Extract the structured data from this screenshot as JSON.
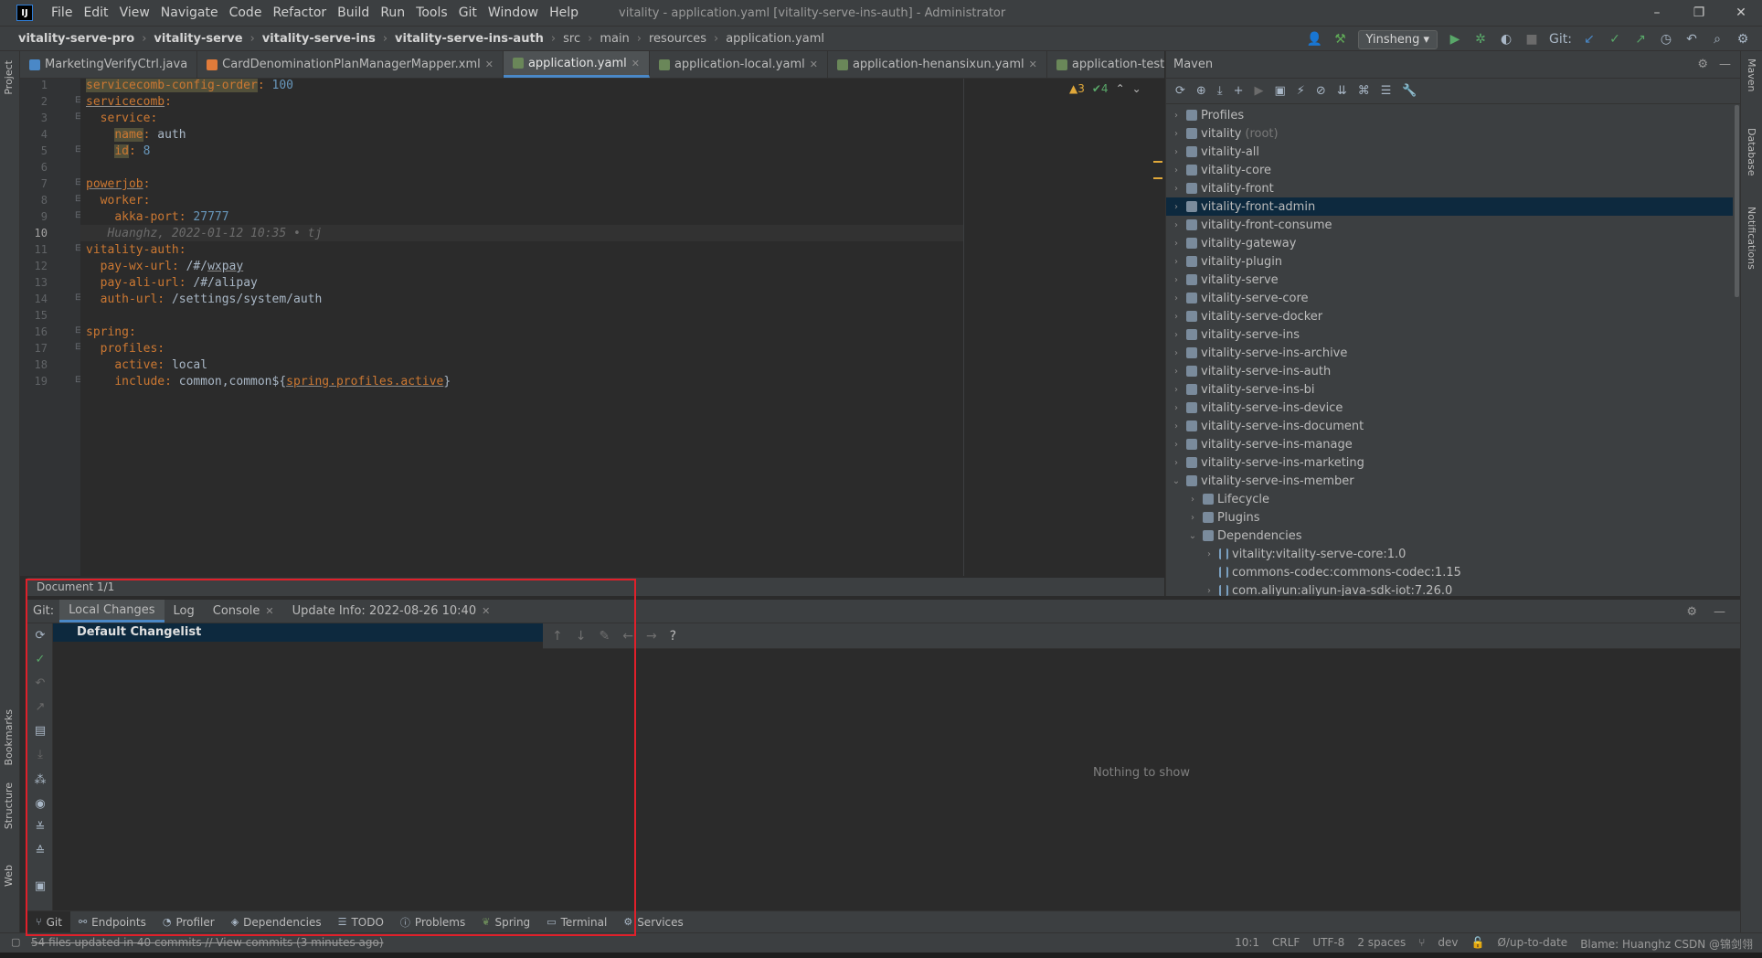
{
  "app": {
    "logo": "IJ",
    "menu": [
      "File",
      "Edit",
      "View",
      "Navigate",
      "Code",
      "Refactor",
      "Build",
      "Run",
      "Tools",
      "Git",
      "Window",
      "Help"
    ],
    "window_title": "vitality - application.yaml [vitality-serve-ins-auth] - Administrator",
    "window_controls": [
      "–",
      "❐",
      "✕"
    ]
  },
  "breadcrumb": [
    "vitality-serve-pro",
    "vitality-serve",
    "vitality-serve-ins",
    "vitality-serve-ins-auth",
    "src",
    "main",
    "resources",
    "application.yaml"
  ],
  "toolbar": {
    "run_config": "Yinsheng ▾",
    "git_label": "Git:"
  },
  "left_strip": [
    "Project",
    "Bookmarks",
    "Structure",
    "Web"
  ],
  "right_strip": [
    "Maven",
    "Database",
    "Notifications"
  ],
  "editor_tabs": [
    {
      "label": "MarketingVerifyCtrl.java",
      "icon_color": "#4a88c7",
      "active": false
    },
    {
      "label": "CardDenominationPlanManagerMapper.xml",
      "icon_color": "#e07b3a",
      "active": false
    },
    {
      "label": "application.yaml",
      "icon_color": "#6a8759",
      "active": true
    },
    {
      "label": "application-local.yaml",
      "icon_color": "#6a8759",
      "active": false
    },
    {
      "label": "application-henansixun.yaml",
      "icon_color": "#6a8759",
      "active": false
    },
    {
      "label": "application-test.yaml",
      "icon_color": "#6a8759",
      "active": false
    }
  ],
  "inspections": {
    "warnings": "▲3",
    "ok": "✔4"
  },
  "code": {
    "l1_key": "servicecomb-config-order",
    "l1_val": "100",
    "l2_key": "servicecomb",
    "l3_key": "service",
    "l4_key": "name",
    "l4_val": "auth",
    "l5_key": "id",
    "l5_val": "8",
    "l7_key": "powerjob",
    "l8_key": "worker",
    "l9_key": "akka-port",
    "l9_val": "27777",
    "l10_blame": "Huanghz, 2022-01-12 10:35 • tj",
    "l11_key": "vitality-auth",
    "l12_key": "pay-wx-url",
    "l12_val_a": "/#/",
    "l12_val_b": "wxpay",
    "l13_key": "pay-ali-url",
    "l13_val": "/#/alipay",
    "l14_key": "auth-url",
    "l14_val": "/settings/system/auth",
    "l16_key": "spring",
    "l17_key": "profiles",
    "l18_key": "active",
    "l18_val": "local",
    "l19_key": "include",
    "l19_val_a": "common,common${",
    "l19_val_b": "spring.profiles.active",
    "l19_val_c": "}"
  },
  "line_numbers": [
    "1",
    "2",
    "3",
    "4",
    "5",
    "6",
    "7",
    "8",
    "9",
    "10",
    "11",
    "12",
    "13",
    "14",
    "15",
    "16",
    "17",
    "18",
    "19"
  ],
  "doc_status": "Document 1/1",
  "maven": {
    "title": "Maven",
    "root_hint": "(root)",
    "items": [
      "Profiles",
      "vitality",
      "vitality-all",
      "vitality-core",
      "vitality-front",
      "vitality-front-admin",
      "vitality-front-consume",
      "vitality-gateway",
      "vitality-plugin",
      "vitality-serve",
      "vitality-serve-core",
      "vitality-serve-docker",
      "vitality-serve-ins",
      "vitality-serve-ins-archive",
      "vitality-serve-ins-auth",
      "vitality-serve-ins-bi",
      "vitality-serve-ins-device",
      "vitality-serve-ins-document",
      "vitality-serve-ins-manage",
      "vitality-serve-ins-marketing",
      "vitality-serve-ins-member"
    ],
    "children": [
      "Lifecycle",
      "Plugins",
      "Dependencies"
    ],
    "deps": [
      "vitality:vitality-serve-core:1.0",
      "commons-codec:commons-codec:1.15",
      "com.aliyun:aliyun-java-sdk-iot:7.26.0"
    ]
  },
  "git": {
    "title": "Git:",
    "tabs": [
      {
        "label": "Local Changes",
        "closable": false,
        "active": true
      },
      {
        "label": "Log",
        "closable": false,
        "active": false
      },
      {
        "label": "Console",
        "closable": true,
        "active": false
      },
      {
        "label": "Update Info: 2022-08-26 10:40",
        "closable": true,
        "active": false
      }
    ],
    "changelist": "Default Changelist",
    "empty_text": "Nothing to show",
    "diff_help": "?"
  },
  "tool_tabs": [
    "Git",
    "Endpoints",
    "Profiler",
    "Dependencies",
    "TODO",
    "Problems",
    "Spring",
    "Terminal",
    "Services"
  ],
  "status": {
    "message": "54 files updated in 40 commits // View commits (3 minutes ago)",
    "position": "10:1",
    "line_sep": "CRLF",
    "encoding": "UTF-8",
    "indent": "2 spaces",
    "branch": "dev",
    "vcs": "Ø/up-to-date",
    "blame": "Blame: Huanghz CSDN @锦剑翎"
  },
  "colors": {
    "accent": "#4a88c7",
    "annotation": "#e0202a",
    "selection": "#0d293e"
  }
}
